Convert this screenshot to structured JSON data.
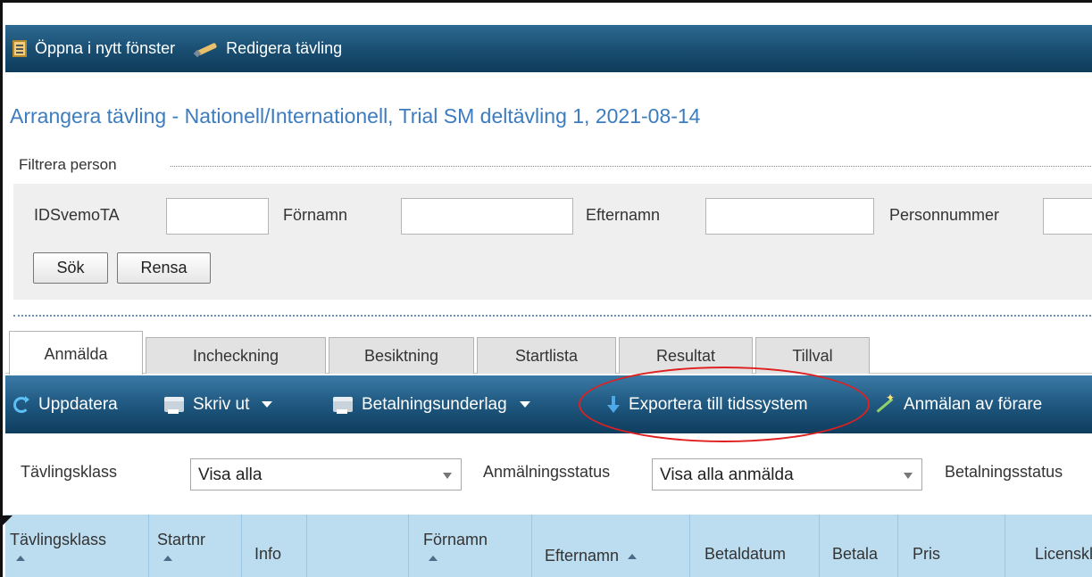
{
  "toolbar": {
    "open_window": "Öppna i nytt fönster",
    "edit_competition": "Redigera tävling"
  },
  "page_title": "Arrangera tävling - Nationell/Internationell, Trial SM deltävling 1, 2021-08-14",
  "filter": {
    "legend": "Filtrera person",
    "labels": {
      "id": "IDSvemoTA",
      "firstname": "Förnamn",
      "lastname": "Efternamn",
      "personnummer": "Personnummer"
    },
    "search_button": "Sök",
    "clear_button": "Rensa"
  },
  "tabs": [
    {
      "label": "Anmälda",
      "active": true
    },
    {
      "label": "Incheckning"
    },
    {
      "label": "Besiktning"
    },
    {
      "label": "Startlista"
    },
    {
      "label": "Resultat"
    },
    {
      "label": "Tillval"
    }
  ],
  "actions": {
    "refresh": "Uppdatera",
    "print": "Skriv ut",
    "payment": "Betalningsunderlag",
    "export": "Exportera till tidssystem",
    "driver_registration": "Anmälan av förare"
  },
  "list_filters": {
    "class_label": "Tävlingsklass",
    "class_value": "Visa alla",
    "status_label": "Anmälningsstatus",
    "status_value": "Visa alla anmälda",
    "payment_label": "Betalningsstatus"
  },
  "grid_columns": [
    {
      "label": "Tävlingsklass"
    },
    {
      "label": "Startnr"
    },
    {
      "label": "Info"
    },
    {
      "label": ""
    },
    {
      "label": "Förnamn"
    },
    {
      "label": "Efternamn"
    },
    {
      "label": "Betaldatum"
    },
    {
      "label": "Betala"
    },
    {
      "label": "Pris"
    },
    {
      "label": "Licenskla"
    }
  ],
  "colors": {
    "toolbar": "#1a4f73",
    "heading": "#3c7cbf",
    "grid_header": "#bcdcf0",
    "annotation": "#e02020"
  }
}
